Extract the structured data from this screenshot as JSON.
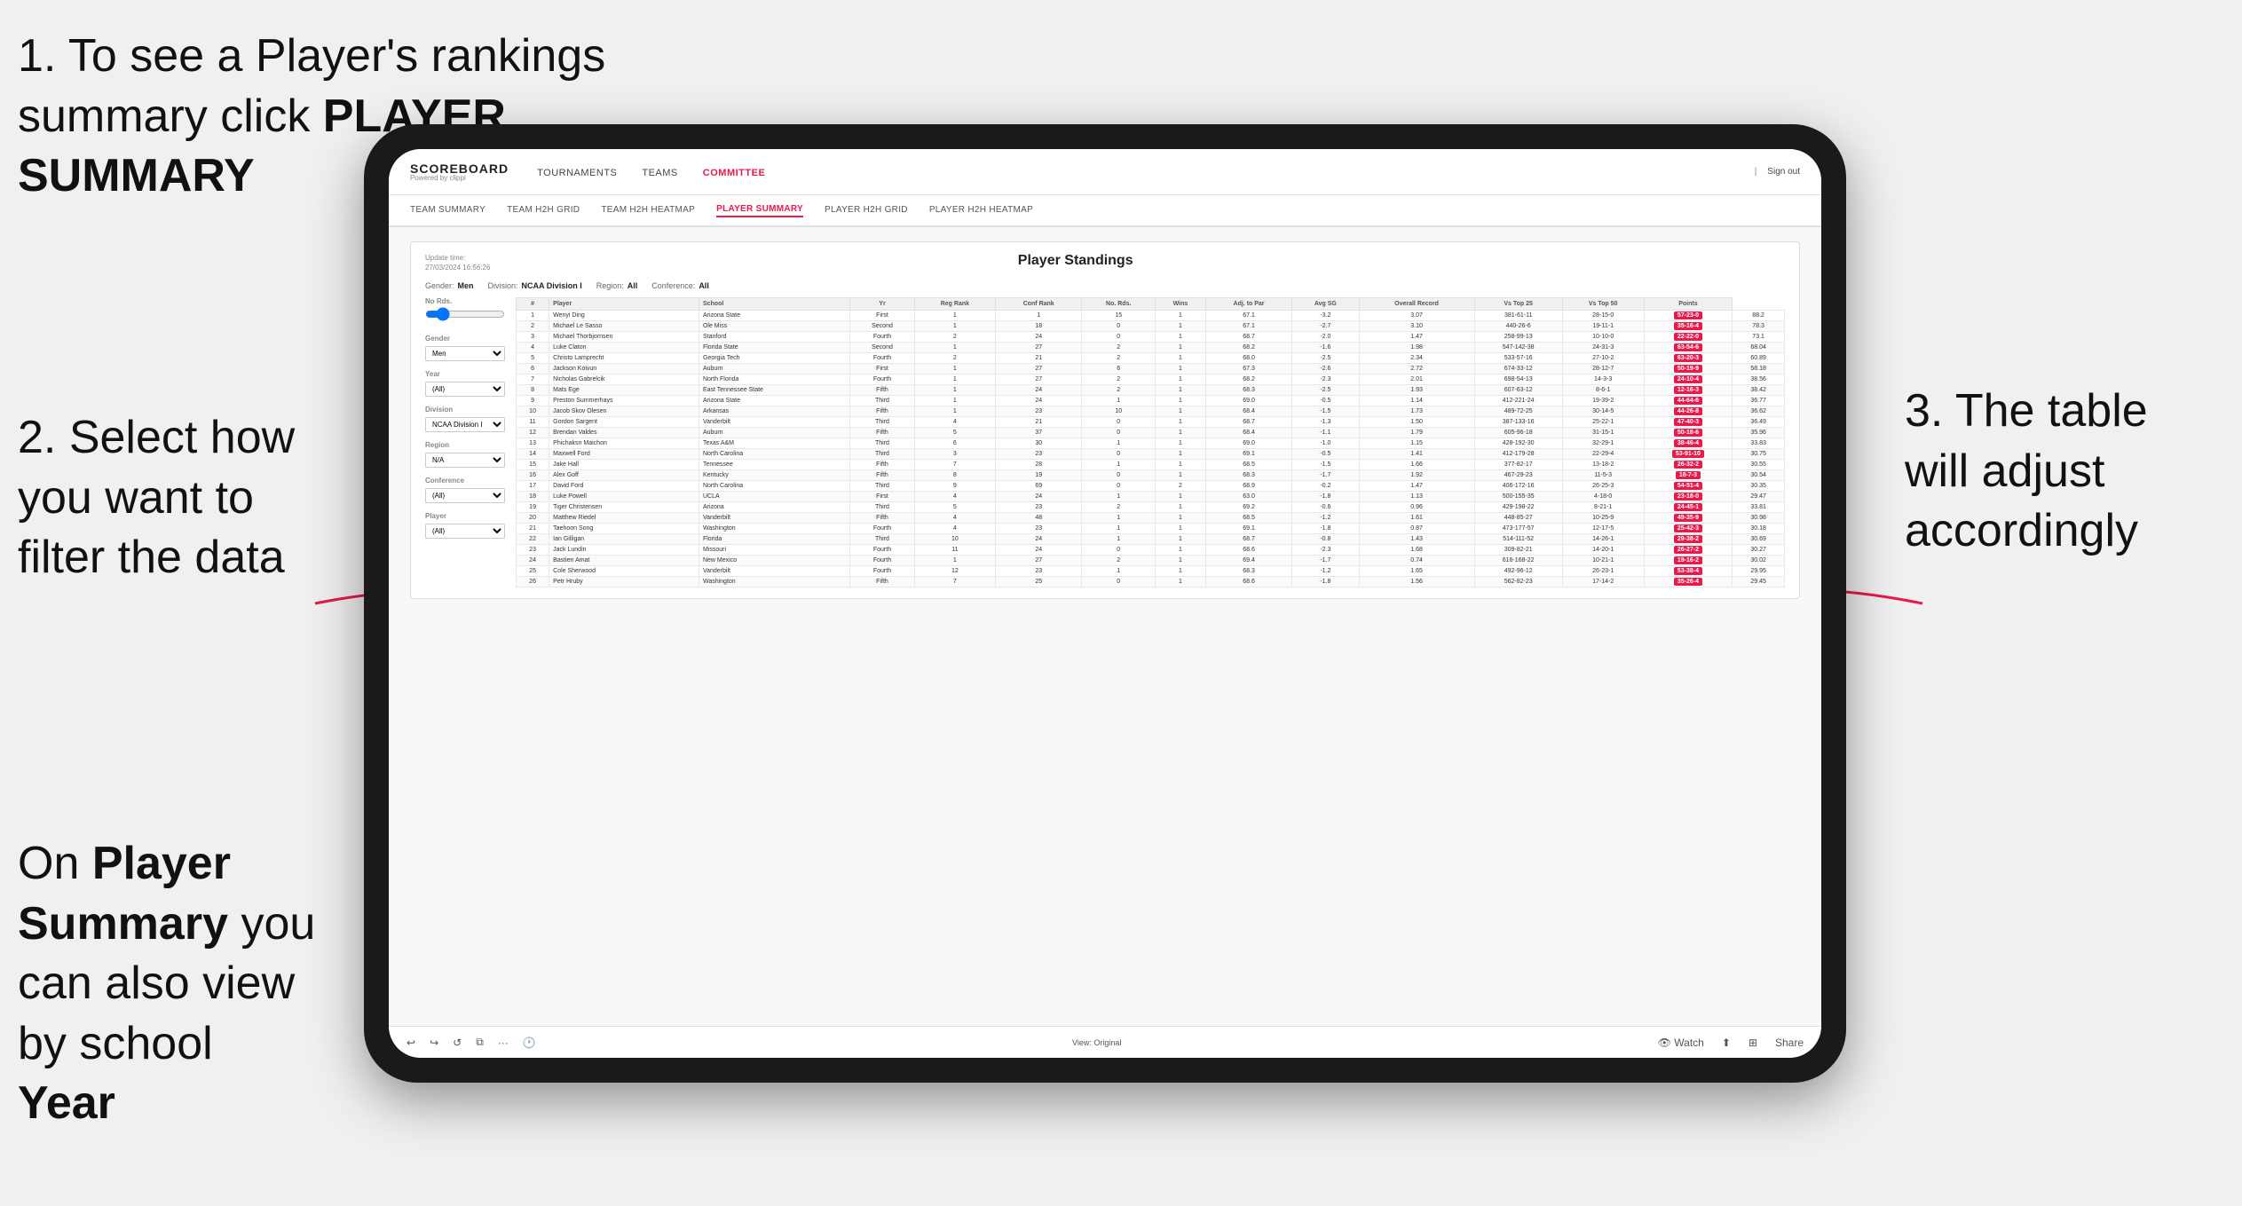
{
  "annotations": {
    "step1": "1. To see a Player's rankings summary click ",
    "step1_bold": "PLAYER SUMMARY",
    "step2_title": "2. Select how you want to filter the data",
    "step3_title": "3. The table will adjust accordingly",
    "bottom_note_prefix": "On ",
    "bottom_note_bold1": "Player Summary",
    "bottom_note_mid": " you can also view by school ",
    "bottom_note_bold2": "Year"
  },
  "navbar": {
    "logo": "SCOREBOARD",
    "logo_sub": "Powered by clippi",
    "nav_items": [
      "TOURNAMENTS",
      "TEAMS",
      "COMMITTEE"
    ],
    "sign_out": "Sign out"
  },
  "subnav": {
    "items": [
      "TEAM SUMMARY",
      "TEAM H2H GRID",
      "TEAM H2H HEATMAP",
      "PLAYER SUMMARY",
      "PLAYER H2H GRID",
      "PLAYER H2H HEATMAP"
    ],
    "active": "PLAYER SUMMARY"
  },
  "card": {
    "title": "Player Standings",
    "update_time": "Update time:\n27/03/2024 16:56:26",
    "filters": {
      "gender_label": "Gender:",
      "gender_value": "Men",
      "division_label": "Division:",
      "division_value": "NCAA Division I",
      "region_label": "Region:",
      "region_value": "All",
      "conference_label": "Conference:",
      "conference_value": "All"
    }
  },
  "sidebar_filters": {
    "no_rds_label": "No Rds.",
    "gender_label": "Gender",
    "gender_value": "Men",
    "year_label": "Year",
    "year_value": "(All)",
    "division_label": "Division",
    "division_value": "NCAA Division I",
    "region_label": "Region",
    "region_value": "N/A",
    "conference_label": "Conference",
    "conference_value": "(All)",
    "player_label": "Player",
    "player_value": "(All)"
  },
  "table": {
    "headers": [
      "#",
      "Player",
      "School",
      "Yr",
      "Reg Rank",
      "Conf Rank",
      "No. Rds.",
      "Wins",
      "Adj. to Par",
      "Avg SG",
      "Overall Record",
      "Vs Top 25",
      "Vs Top 50",
      "Points"
    ],
    "rows": [
      [
        "1",
        "Wenyi Ding",
        "Arizona State",
        "First",
        "1",
        "1",
        "15",
        "1",
        "67.1",
        "-3.2",
        "3.07",
        "381-61-11",
        "28-15-0",
        "57-23-0",
        "88.2"
      ],
      [
        "2",
        "Michael Le Sasso",
        "Ole Miss",
        "Second",
        "1",
        "18",
        "0",
        "1",
        "67.1",
        "-2.7",
        "3.10",
        "440-26-6",
        "19-11-1",
        "35-16-4",
        "78.3"
      ],
      [
        "3",
        "Michael Thorbjornsen",
        "Stanford",
        "Fourth",
        "2",
        "24",
        "0",
        "1",
        "68.7",
        "-2.0",
        "1.47",
        "258-99-13",
        "10-10-0",
        "22-22-0",
        "73.1"
      ],
      [
        "4",
        "Luke Claton",
        "Florida State",
        "Second",
        "1",
        "27",
        "2",
        "1",
        "68.2",
        "-1.6",
        "1.98",
        "547-142-38",
        "24-31-3",
        "63-54-6",
        "68.04"
      ],
      [
        "5",
        "Christo Lamprecht",
        "Georgia Tech",
        "Fourth",
        "2",
        "21",
        "2",
        "1",
        "68.0",
        "-2.5",
        "2.34",
        "533-57-16",
        "27-10-2",
        "63-20-3",
        "60.89"
      ],
      [
        "6",
        "Jackson Koivun",
        "Auburn",
        "First",
        "1",
        "27",
        "6",
        "1",
        "67.3",
        "-2.6",
        "2.72",
        "674-33-12",
        "28-12-7",
        "50-19-9",
        "58.18"
      ],
      [
        "7",
        "Nicholas Gabrelcik",
        "North Florida",
        "Fourth",
        "1",
        "27",
        "2",
        "1",
        "68.2",
        "-2.3",
        "2.01",
        "698-54-13",
        "14-3-3",
        "24-10-4",
        "38.56"
      ],
      [
        "8",
        "Mats Ege",
        "East Tennessee State",
        "Fifth",
        "1",
        "24",
        "2",
        "1",
        "68.3",
        "-2.5",
        "1.93",
        "607-63-12",
        "8-6-1",
        "12-16-3",
        "38.42"
      ],
      [
        "9",
        "Preston Summerhays",
        "Arizona State",
        "Third",
        "1",
        "24",
        "1",
        "1",
        "69.0",
        "-0.5",
        "1.14",
        "412-221-24",
        "19-39-2",
        "44-64-6",
        "36.77"
      ],
      [
        "10",
        "Jacob Skov Olesen",
        "Arkansas",
        "Fifth",
        "1",
        "23",
        "10",
        "1",
        "68.4",
        "-1.5",
        "1.73",
        "489-72-25",
        "30-14-5",
        "44-26-8",
        "36.62"
      ],
      [
        "11",
        "Gordon Sargent",
        "Vanderbilt",
        "Third",
        "4",
        "21",
        "0",
        "1",
        "68.7",
        "-1.3",
        "1.50",
        "387-133-16",
        "25-22-1",
        "47-40-3",
        "36.49"
      ],
      [
        "12",
        "Brendan Valdes",
        "Auburn",
        "Fifth",
        "5",
        "37",
        "0",
        "1",
        "68.4",
        "-1.1",
        "1.79",
        "605-96-18",
        "31-15-1",
        "50-18-6",
        "35.96"
      ],
      [
        "13",
        "Phichaksn Maichon",
        "Texas A&M",
        "Third",
        "6",
        "30",
        "1",
        "1",
        "69.0",
        "-1.0",
        "1.15",
        "428-192-30",
        "32-29-1",
        "38-46-4",
        "33.83"
      ],
      [
        "14",
        "Maxwell Ford",
        "North Carolina",
        "Third",
        "3",
        "23",
        "0",
        "1",
        "69.1",
        "-0.5",
        "1.41",
        "412-179-28",
        "22-29-4",
        "53-91-10",
        "30.75"
      ],
      [
        "15",
        "Jake Hall",
        "Tennessee",
        "Fifth",
        "7",
        "28",
        "1",
        "1",
        "68.5",
        "-1.5",
        "1.66",
        "377-82-17",
        "13-18-2",
        "26-32-2",
        "30.55"
      ],
      [
        "16",
        "Alex Goff",
        "Kentucky",
        "Fifth",
        "8",
        "19",
        "0",
        "1",
        "68.3",
        "-1.7",
        "1.92",
        "467-29-23",
        "11-5-3",
        "18-7-3",
        "30.54"
      ],
      [
        "17",
        "David Ford",
        "North Carolina",
        "Third",
        "9",
        "69",
        "0",
        "2",
        "68.9",
        "-0.2",
        "1.47",
        "406-172-16",
        "26-25-3",
        "54-51-4",
        "30.35"
      ],
      [
        "18",
        "Luke Powell",
        "UCLA",
        "First",
        "4",
        "24",
        "1",
        "1",
        "63.0",
        "-1.8",
        "1.13",
        "500-155-35",
        "4-18-0",
        "23-18-0",
        "29.47"
      ],
      [
        "19",
        "Tiger Christensen",
        "Arizona",
        "Third",
        "5",
        "23",
        "2",
        "1",
        "69.2",
        "-0.6",
        "0.96",
        "429-198-22",
        "8-21-1",
        "24-45-1",
        "33.81"
      ],
      [
        "20",
        "Matthew Riedel",
        "Vanderbilt",
        "Fifth",
        "4",
        "48",
        "1",
        "1",
        "68.5",
        "-1.2",
        "1.61",
        "448-85-27",
        "10-25-9",
        "49-35-9",
        "30.98"
      ],
      [
        "21",
        "Taehoon Song",
        "Washington",
        "Fourth",
        "4",
        "23",
        "1",
        "1",
        "69.1",
        "-1.8",
        "0.87",
        "473-177-57",
        "12-17-5",
        "25-42-3",
        "30.18"
      ],
      [
        "22",
        "Ian Gilligan",
        "Florida",
        "Third",
        "10",
        "24",
        "1",
        "1",
        "68.7",
        "-0.8",
        "1.43",
        "514-111-52",
        "14-26-1",
        "29-38-2",
        "30.69"
      ],
      [
        "23",
        "Jack Lundin",
        "Missouri",
        "Fourth",
        "11",
        "24",
        "0",
        "1",
        "68.6",
        "-2.3",
        "1.68",
        "309-82-21",
        "14-20-1",
        "26-27-2",
        "30.27"
      ],
      [
        "24",
        "Bastien Amat",
        "New Mexico",
        "Fourth",
        "1",
        "27",
        "2",
        "1",
        "69.4",
        "-1.7",
        "0.74",
        "616-168-22",
        "10-21-1",
        "19-16-2",
        "30.02"
      ],
      [
        "25",
        "Cole Sherwood",
        "Vanderbilt",
        "Fourth",
        "12",
        "23",
        "1",
        "1",
        "68.3",
        "-1.2",
        "1.65",
        "492-96-12",
        "26-23-1",
        "53-38-4",
        "29.95"
      ],
      [
        "26",
        "Petr Hruby",
        "Washington",
        "Fifth",
        "7",
        "25",
        "0",
        "1",
        "68.6",
        "-1.8",
        "1.56",
        "562-82-23",
        "17-14-2",
        "35-26-4",
        "29.45"
      ]
    ]
  },
  "toolbar": {
    "view_label": "View: Original",
    "watch_label": "Watch",
    "share_label": "Share"
  }
}
